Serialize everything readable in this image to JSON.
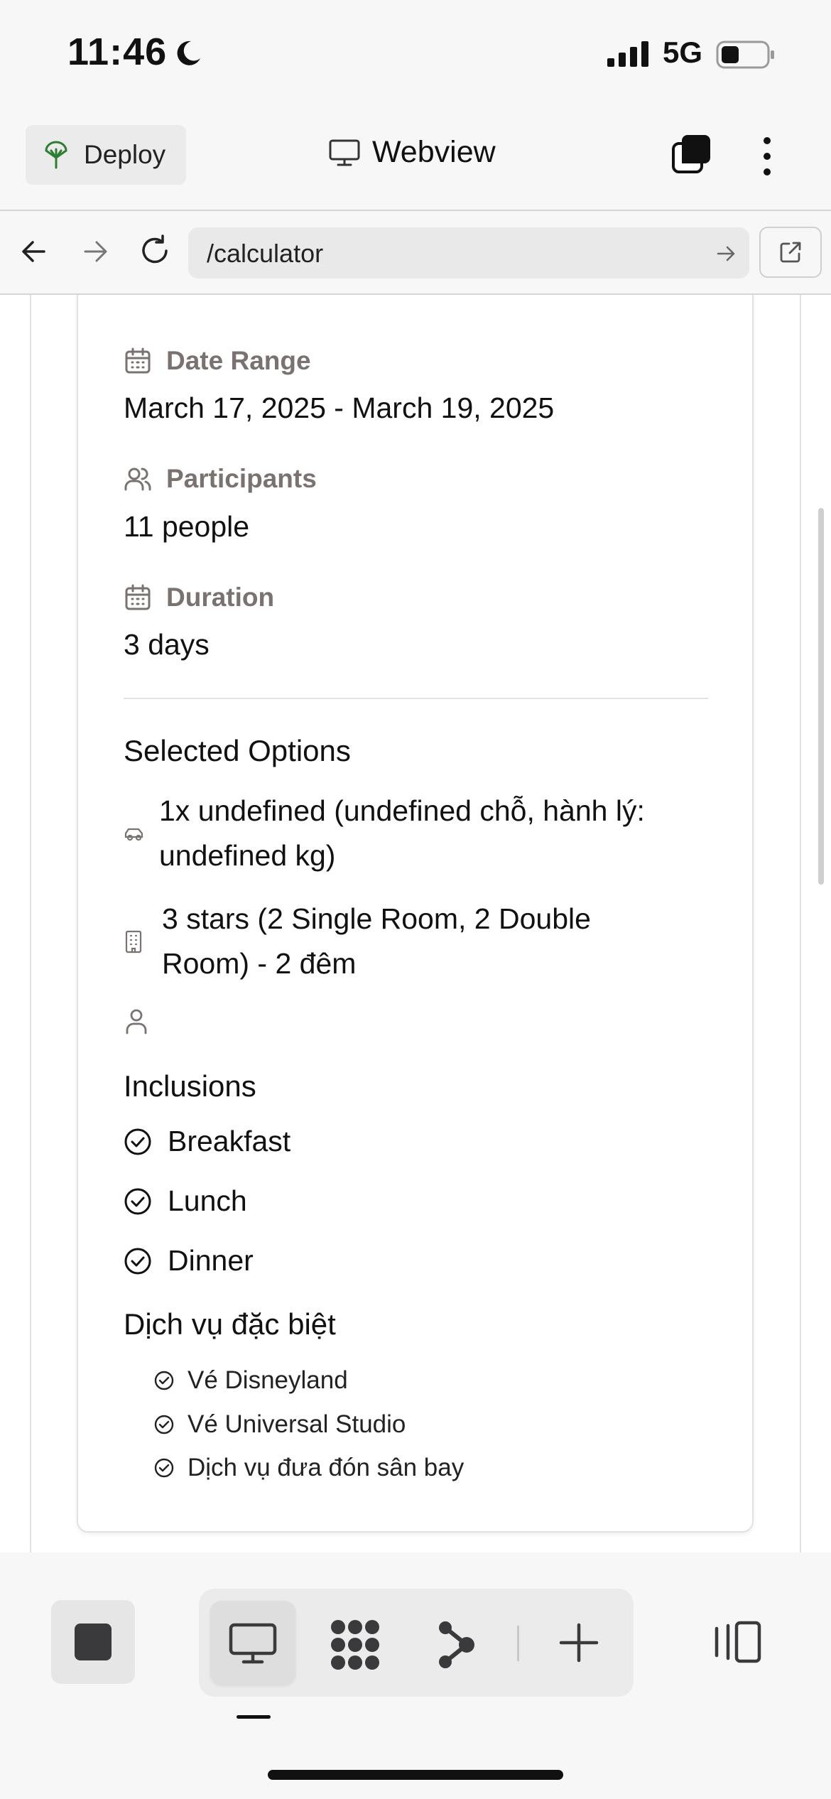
{
  "status_bar": {
    "time": "11:46",
    "network": "5G"
  },
  "app_bar": {
    "deploy_label": "Deploy",
    "title": "Webview"
  },
  "nav": {
    "url": "/calculator"
  },
  "details": {
    "date_range_label": "Date Range",
    "date_range_value": "March 17, 2025 - March 19, 2025",
    "participants_label": "Participants",
    "participants_value": "11 people",
    "duration_label": "Duration",
    "duration_value": "3 days"
  },
  "selected_options": {
    "title": "Selected Options",
    "items": [
      {
        "icon": "car-icon",
        "text": "1x undefined (undefined chỗ, hành lý: undefined kg)"
      },
      {
        "icon": "building-icon",
        "text": "3 stars (2 Single Room, 2 Double Room) - 2 đêm"
      },
      {
        "icon": "person-icon",
        "text": ""
      }
    ]
  },
  "inclusions": {
    "title": "Inclusions",
    "items": [
      "Breakfast",
      "Lunch",
      "Dinner"
    ]
  },
  "special_services": {
    "title": "Dịch vụ đặc biệt",
    "items": [
      "Vé Disneyland",
      "Vé Universal Studio",
      "Dịch vụ đưa đón sân bay"
    ]
  },
  "colors": {
    "label_gray": "#7a7270",
    "deploy_icon_green": "#2e7d32",
    "background": "#f7f7f7"
  }
}
